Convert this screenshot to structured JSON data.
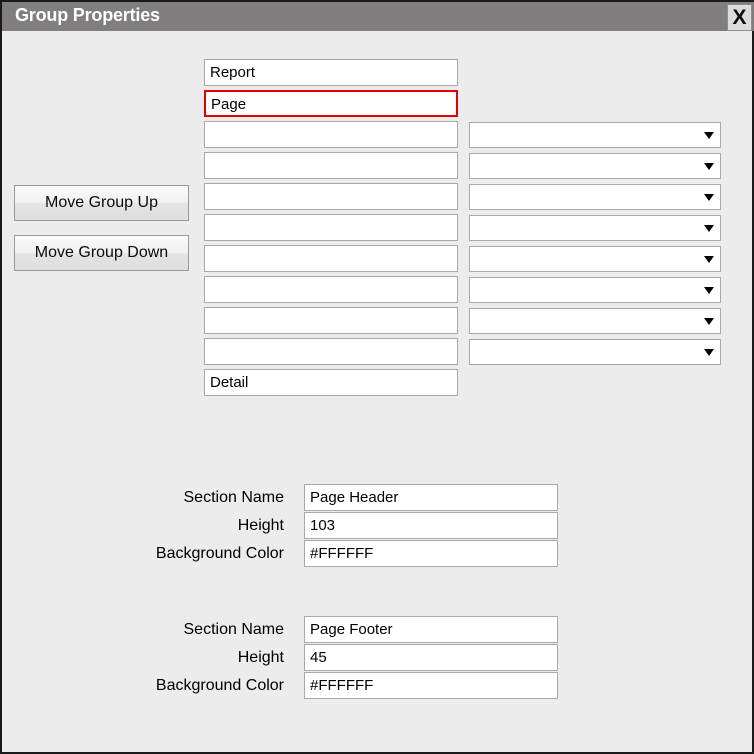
{
  "window": {
    "title": "Group Properties",
    "close_label": "X",
    "close_icon": "close-x-icon"
  },
  "group_list": {
    "rows": [
      {
        "name": "Report",
        "selected": false,
        "has_dropdown": false,
        "dropdown_value": ""
      },
      {
        "name": "Page",
        "selected": true,
        "has_dropdown": false,
        "dropdown_value": ""
      },
      {
        "name": "",
        "selected": false,
        "has_dropdown": true,
        "dropdown_value": ""
      },
      {
        "name": "",
        "selected": false,
        "has_dropdown": true,
        "dropdown_value": ""
      },
      {
        "name": "",
        "selected": false,
        "has_dropdown": true,
        "dropdown_value": ""
      },
      {
        "name": "",
        "selected": false,
        "has_dropdown": true,
        "dropdown_value": ""
      },
      {
        "name": "",
        "selected": false,
        "has_dropdown": true,
        "dropdown_value": ""
      },
      {
        "name": "",
        "selected": false,
        "has_dropdown": true,
        "dropdown_value": ""
      },
      {
        "name": "",
        "selected": false,
        "has_dropdown": true,
        "dropdown_value": ""
      },
      {
        "name": "",
        "selected": false,
        "has_dropdown": true,
        "dropdown_value": ""
      },
      {
        "name": "Detail",
        "selected": false,
        "has_dropdown": false,
        "dropdown_value": ""
      }
    ]
  },
  "buttons": {
    "move_up": "Move Group Up",
    "move_down": "Move Group Down"
  },
  "sections": [
    {
      "labels": {
        "section_name": "Section Name",
        "height": "Height",
        "background_color": "Background Color"
      },
      "values": {
        "section_name": "Page Header",
        "height": "103",
        "background_color": "#FFFFFF"
      }
    },
    {
      "labels": {
        "section_name": "Section Name",
        "height": "Height",
        "background_color": "Background Color"
      },
      "values": {
        "section_name": "Page Footer",
        "height": "45",
        "background_color": "#FFFFFF"
      }
    }
  ],
  "colors": {
    "titlebar": "#807E7E",
    "dialog_background": "#ECECEC",
    "field_background": "#FFFFFF",
    "field_border": "#A9A9A9",
    "selection_border": "#E00000",
    "window_border": "#1A1A1A"
  }
}
